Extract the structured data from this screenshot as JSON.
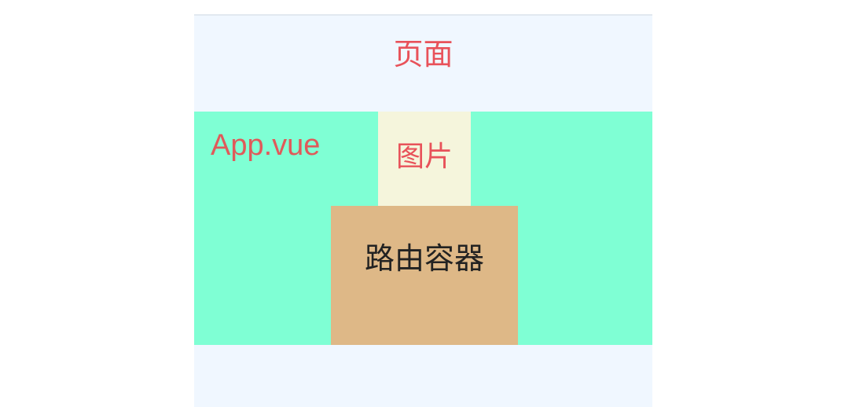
{
  "page": {
    "label": "页面"
  },
  "app": {
    "label": "App.vue"
  },
  "image": {
    "label": "图片"
  },
  "router": {
    "label": "路由容器"
  },
  "colors": {
    "page_background": "#f0f7ff",
    "app_background": "#7fffd4",
    "image_background": "#f5f5dc",
    "router_background": "#deb887",
    "label_red": "#e8525a",
    "label_dark": "#222222"
  }
}
